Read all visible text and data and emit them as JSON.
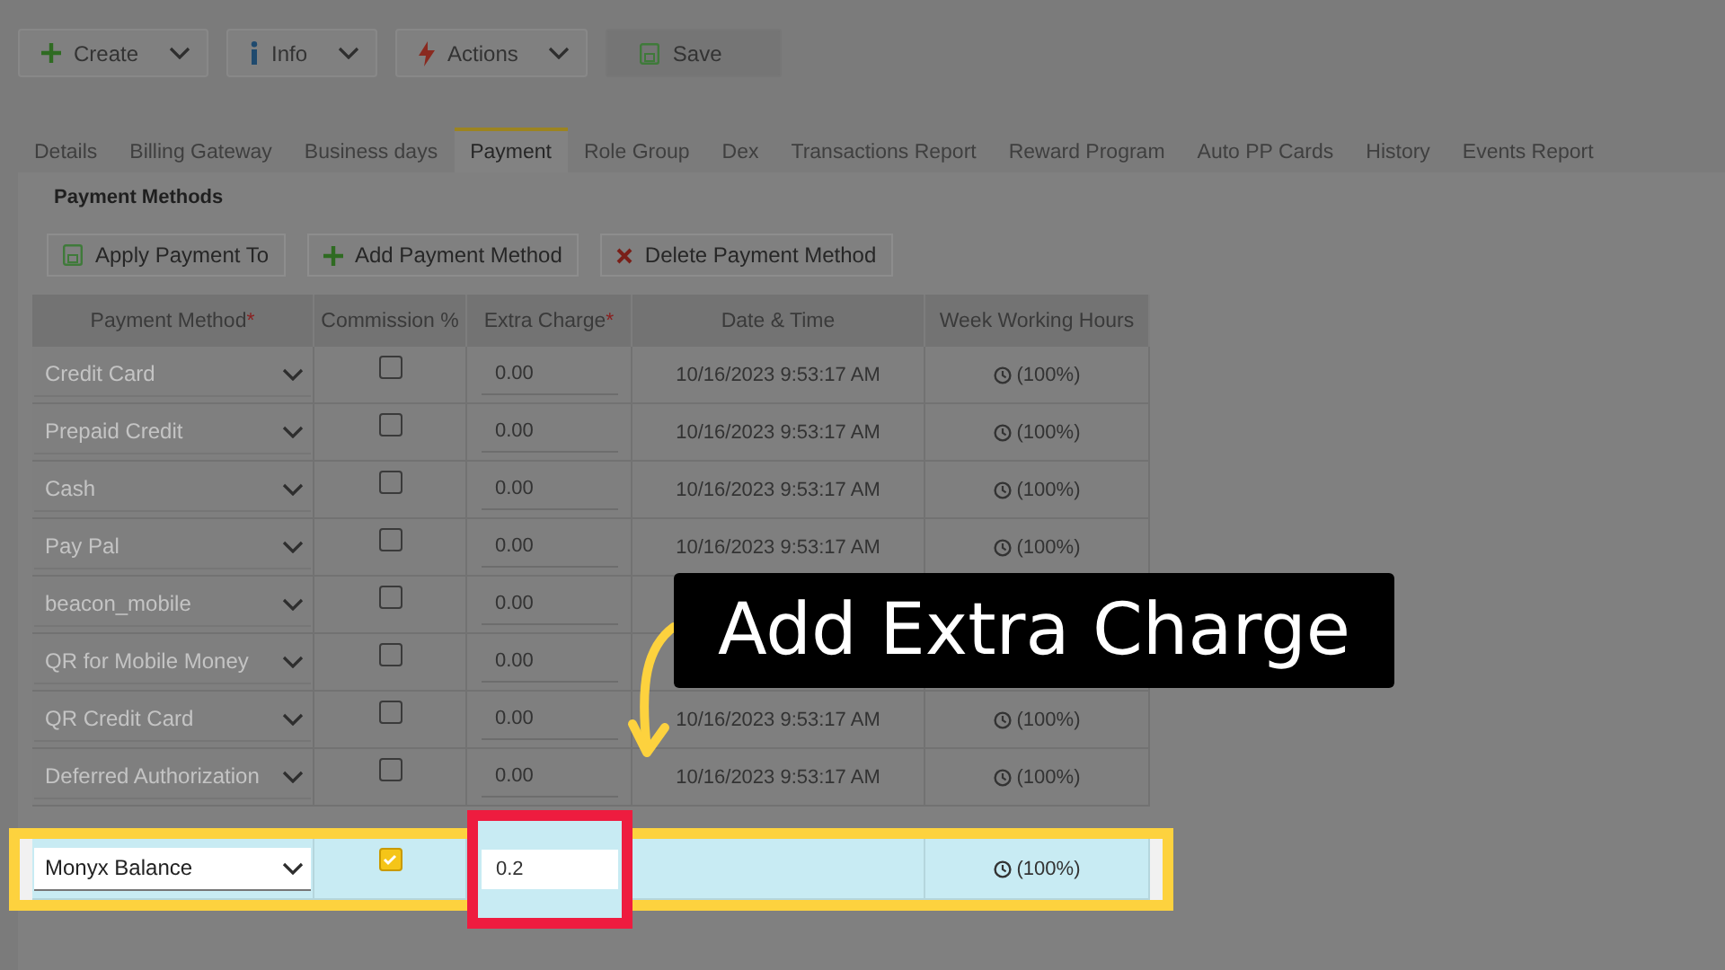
{
  "toolbar": [
    {
      "label": "Create",
      "kind": "plus",
      "dropdown": true
    },
    {
      "label": "Info",
      "kind": "info",
      "dropdown": true
    },
    {
      "label": "Actions",
      "kind": "bolt",
      "dropdown": true
    },
    {
      "label": "Save",
      "kind": "save",
      "dropdown": false
    }
  ],
  "tabs": [
    {
      "label": "Details",
      "selected": false
    },
    {
      "label": "Billing Gateway",
      "selected": false
    },
    {
      "label": "Business days",
      "selected": false
    },
    {
      "label": "Payment",
      "selected": true
    },
    {
      "label": "Role Group",
      "selected": false
    },
    {
      "label": "Dex",
      "selected": false
    },
    {
      "label": "Transactions Report",
      "selected": false
    },
    {
      "label": "Reward Program",
      "selected": false
    },
    {
      "label": "Auto PP Cards",
      "selected": false
    },
    {
      "label": "History",
      "selected": false
    },
    {
      "label": "Events Report",
      "selected": false
    }
  ],
  "section_title": "Payment Methods",
  "actions": [
    {
      "label": "Apply Payment To",
      "kind": "save"
    },
    {
      "label": "Add Payment Method",
      "kind": "plus"
    },
    {
      "label": "Delete Payment Method",
      "kind": "delete"
    }
  ],
  "table": {
    "columns": [
      {
        "label": "Payment Method",
        "required_mark": "*"
      },
      {
        "label": "Commission %"
      },
      {
        "label": "Extra Charge",
        "required_mark": "*"
      },
      {
        "label": "Date & Time"
      },
      {
        "label": "Week Working Hours"
      }
    ],
    "rows": [
      {
        "method": "Credit Card",
        "disabled": true,
        "checked": false,
        "extra": "0.00",
        "date": "10/16/2023 9:53:17 AM",
        "hours": "(100%)",
        "highlighted": false
      },
      {
        "method": "Prepaid Credit",
        "disabled": true,
        "checked": false,
        "extra": "0.00",
        "date": "10/16/2023 9:53:17 AM",
        "hours": "(100%)",
        "highlighted": false
      },
      {
        "method": "Cash",
        "disabled": true,
        "checked": false,
        "extra": "0.00",
        "date": "10/16/2023 9:53:17 AM",
        "hours": "(100%)",
        "highlighted": false
      },
      {
        "method": "Pay Pal",
        "disabled": true,
        "checked": false,
        "extra": "0.00",
        "date": "10/16/2023 9:53:17 AM",
        "hours": "(100%)",
        "highlighted": false
      },
      {
        "method": "beacon_mobile",
        "disabled": true,
        "checked": false,
        "extra": "0.00",
        "highlighted": false
      },
      {
        "method": "QR for Mobile Money",
        "disabled": true,
        "checked": false,
        "extra": "0.00",
        "highlighted": false
      },
      {
        "method": "QR Credit Card",
        "disabled": true,
        "checked": false,
        "extra": "0.00",
        "date": "10/16/2023 9:53:17 AM",
        "hours": "(100%)",
        "highlighted": false
      },
      {
        "method": "Deferred Authorization",
        "disabled": true,
        "checked": false,
        "extra": "0.00",
        "date": "10/16/2023 9:53:17 AM",
        "hours": "(100%)",
        "highlighted": false
      },
      {
        "method": "Monyx Balance",
        "disabled": false,
        "checked": true,
        "extra": "0.2",
        "hours": "(100%)",
        "highlighted": true
      }
    ]
  },
  "callout": "Add Extra Charge"
}
